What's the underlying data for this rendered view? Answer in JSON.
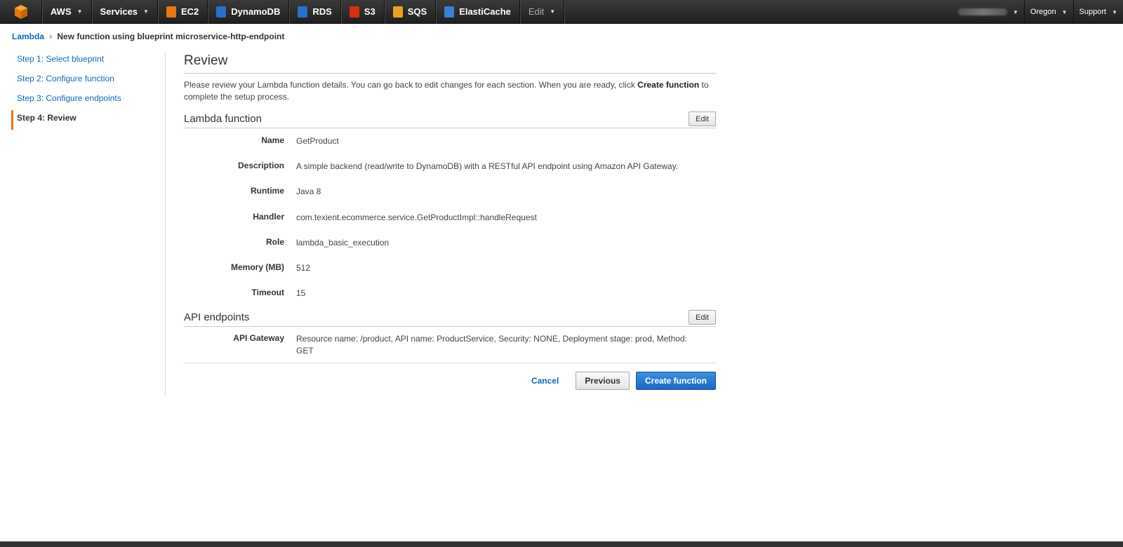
{
  "nav": {
    "aws_label": "AWS",
    "services_label": "Services",
    "services": [
      {
        "label": "EC2",
        "icon": "ec2-icon",
        "color": "#e47911"
      },
      {
        "label": "DynamoDB",
        "icon": "dynamodb-icon",
        "color": "#2a6fc9"
      },
      {
        "label": "RDS",
        "icon": "rds-icon",
        "color": "#2a6fc9"
      },
      {
        "label": "S3",
        "icon": "s3-icon",
        "color": "#d13212"
      },
      {
        "label": "SQS",
        "icon": "sqs-icon",
        "color": "#e7a223"
      },
      {
        "label": "ElastiCache",
        "icon": "elasticache-icon",
        "color": "#3b7fd0"
      }
    ],
    "edit_label": "Edit",
    "region_label": "Oregon",
    "support_label": "Support"
  },
  "breadcrumb": {
    "root": "Lambda",
    "current": "New function using blueprint microservice-http-endpoint"
  },
  "steps": [
    {
      "label": "Step 1: Select blueprint",
      "active": false
    },
    {
      "label": "Step 2: Configure function",
      "active": false
    },
    {
      "label": "Step 3: Configure endpoints",
      "active": false
    },
    {
      "label": "Step 4: Review",
      "active": true
    }
  ],
  "review": {
    "title": "Review",
    "intro_before": "Please review your Lambda function details. You can go back to edit changes for each section. When you are ready, click ",
    "intro_bold": "Create function",
    "intro_after": " to complete the setup process."
  },
  "lambda_function": {
    "title": "Lambda function",
    "edit_label": "Edit",
    "fields": [
      {
        "label": "Name",
        "value": "GetProduct"
      },
      {
        "label": "Description",
        "value": "A simple backend (read/write to DynamoDB) with a RESTful API endpoint using Amazon API Gateway."
      },
      {
        "label": "Runtime",
        "value": "Java 8"
      },
      {
        "label": "Handler",
        "value": "com.texient.ecommerce.service.GetProductImpl::handleRequest"
      },
      {
        "label": "Role",
        "value": "lambda_basic_execution"
      },
      {
        "label": "Memory (MB)",
        "value": "512"
      },
      {
        "label": "Timeout",
        "value": "15"
      }
    ]
  },
  "api_endpoints": {
    "title": "API endpoints",
    "edit_label": "Edit",
    "gateway_label": "API Gateway",
    "gateway_value": "Resource name: /product, API name: ProductService, Security: NONE, Deployment stage: prod, Method: GET"
  },
  "actions": {
    "cancel_label": "Cancel",
    "previous_label": "Previous",
    "create_label": "Create function"
  }
}
